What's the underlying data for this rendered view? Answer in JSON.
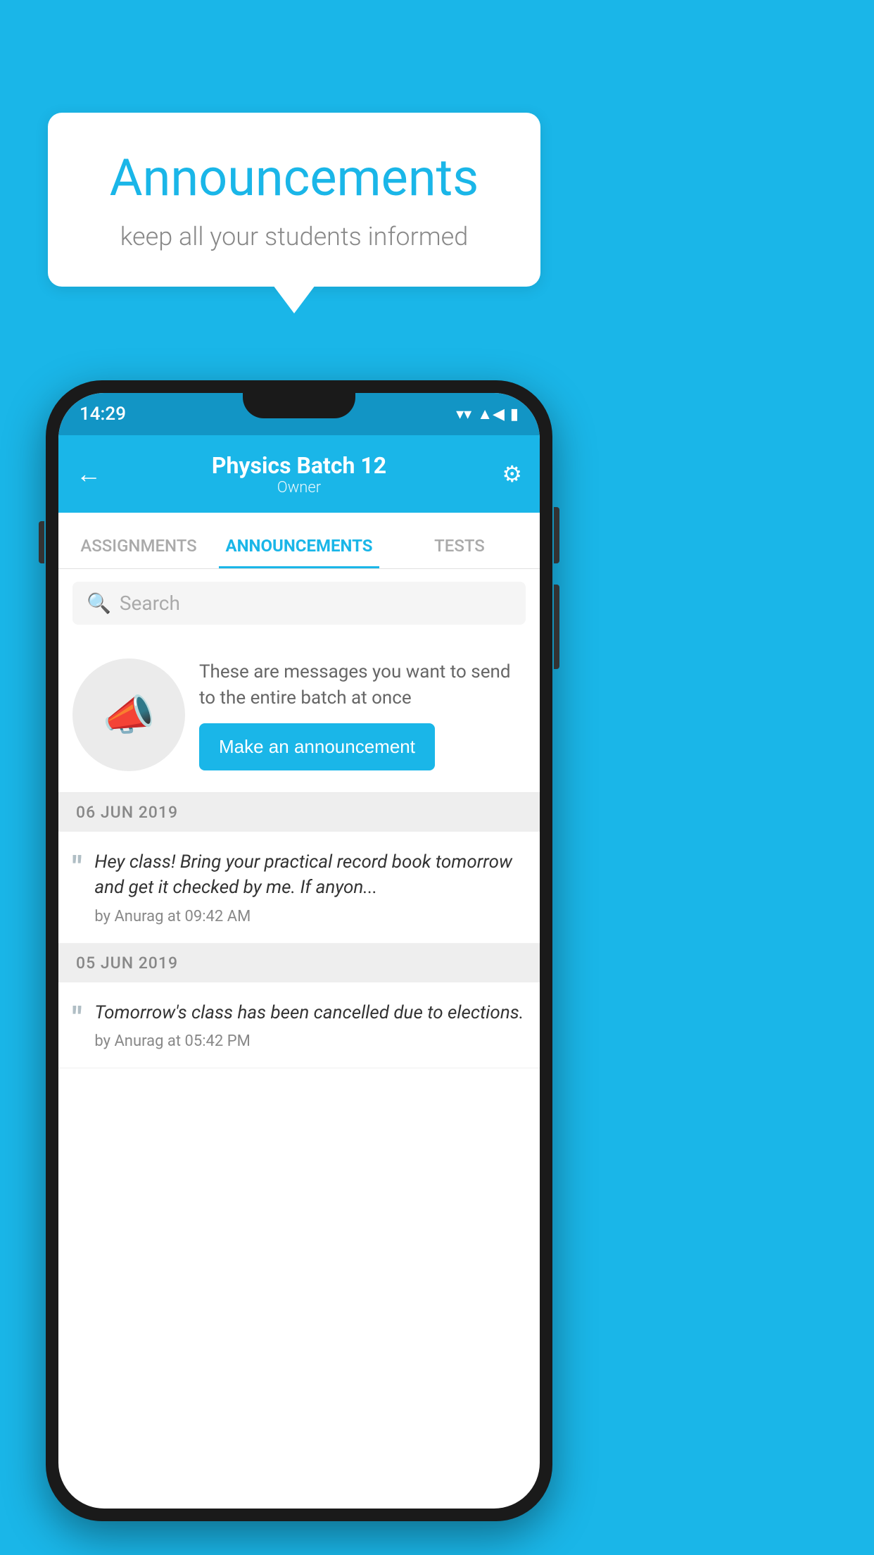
{
  "background_color": "#1ab6e8",
  "speech_bubble": {
    "title": "Announcements",
    "subtitle": "keep all your students informed"
  },
  "phone": {
    "status_bar": {
      "time": "14:29"
    },
    "header": {
      "title": "Physics Batch 12",
      "subtitle": "Owner",
      "back_label": "←",
      "gear_label": "⚙"
    },
    "tabs": [
      {
        "label": "ASSIGNMENTS",
        "active": false
      },
      {
        "label": "ANNOUNCEMENTS",
        "active": true
      },
      {
        "label": "TESTS",
        "active": false
      }
    ],
    "search": {
      "placeholder": "Search"
    },
    "promo": {
      "description": "These are messages you want to send to the entire batch at once",
      "button_label": "Make an announcement"
    },
    "announcements": [
      {
        "date": "06  JUN  2019",
        "text": "Hey class! Bring your practical record book tomorrow and get it checked by me. If anyon...",
        "meta": "by Anurag at 09:42 AM"
      },
      {
        "date": "05  JUN  2019",
        "text": "Tomorrow's class has been cancelled due to elections.",
        "meta": "by Anurag at 05:42 PM"
      }
    ]
  }
}
